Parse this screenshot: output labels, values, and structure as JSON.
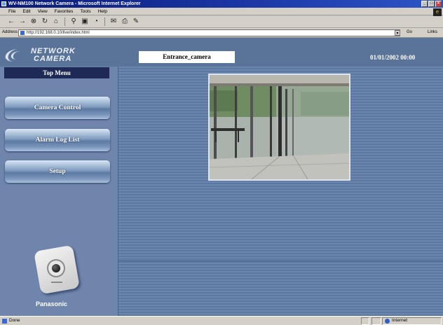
{
  "window": {
    "title": "WV-NM100 Network Camera - Microsoft Internet Explorer",
    "min": "_",
    "max": "□",
    "close": "×"
  },
  "menubar": {
    "items": [
      "File",
      "Edit",
      "View",
      "Favorites",
      "Tools",
      "Help"
    ]
  },
  "toolbar": {
    "buttons": [
      "back-icon",
      "forward-icon",
      "stop-icon",
      "refresh-icon",
      "home-icon",
      "search-icon",
      "favorites-icon",
      "history-icon",
      "mail-icon",
      "print-icon",
      "edit-icon"
    ]
  },
  "address": {
    "label": "Address",
    "url": "http://192.168.0.10/live/index.html",
    "go": "Go",
    "links": "Links"
  },
  "header": {
    "logo_line1": "NETWORK",
    "logo_line2": "CAMERA",
    "camera_name": "Entrance_camera",
    "datetime": "01/01/2002  00:00"
  },
  "sidebar": {
    "title": "Top Menu",
    "buttons": [
      {
        "label": "Camera Control"
      },
      {
        "label": "Alarm Log List"
      },
      {
        "label": "Setup"
      }
    ],
    "brand": "Panasonic"
  },
  "status": {
    "text": "Done",
    "zone": "Internet"
  },
  "colors": {
    "page_bg": "#6a86ae",
    "top_menu_bg": "#1e2a55",
    "title_bar": "#0a1a7a"
  }
}
